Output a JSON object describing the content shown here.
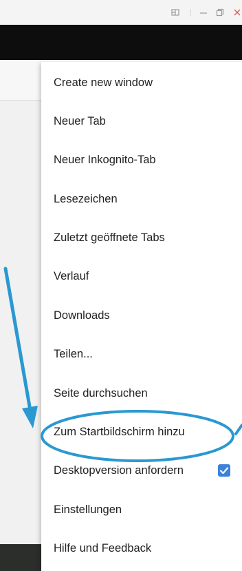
{
  "window": {
    "controls": [
      {
        "icon": "window-snap-icon"
      },
      {
        "icon": "minimize-icon"
      },
      {
        "icon": "restore-icon"
      },
      {
        "icon": "close-icon"
      }
    ]
  },
  "menu": {
    "items": [
      {
        "label": "Create new window"
      },
      {
        "label": "Neuer Tab"
      },
      {
        "label": "Neuer Inkognito-Tab"
      },
      {
        "label": "Lesezeichen"
      },
      {
        "label": "Zuletzt geöffnete Tabs"
      },
      {
        "label": "Verlauf"
      },
      {
        "label": "Downloads"
      },
      {
        "label": "Teilen..."
      },
      {
        "label": "Seite durchsuchen"
      },
      {
        "label": "Zum Startbildschirm hinzu"
      },
      {
        "label": "Desktopversion anfordern",
        "checked": true
      },
      {
        "label": "Einstellungen"
      },
      {
        "label": "Hilfe und Feedback"
      }
    ]
  },
  "annotation": {
    "color": "#2a98d2",
    "highlighted_item": "Zum Startbildschirm hinzu"
  },
  "colors": {
    "toolbar": "#0d0d0d",
    "menu_background": "#ffffff",
    "checkbox": "#3b82d9",
    "close_icon": "#e05a5a"
  }
}
